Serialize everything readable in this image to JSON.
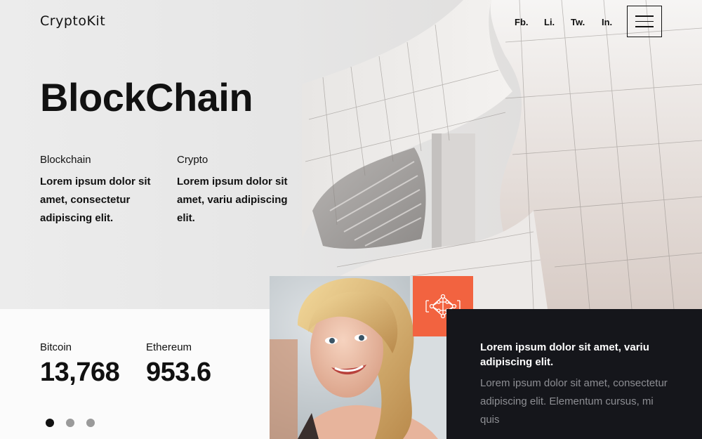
{
  "header": {
    "brand": "CryptoKit",
    "social": [
      {
        "label": "Fb."
      },
      {
        "label": "Li."
      },
      {
        "label": "Tw."
      },
      {
        "label": "In."
      }
    ],
    "menu_icon": "hamburger-menu-icon"
  },
  "hero": {
    "title": "BlockChain",
    "features": [
      {
        "label": "Blockchain",
        "text": "Lorem ipsum dolor sit amet, consectetur adipiscing elit."
      },
      {
        "label": "Crypto",
        "text": "Lorem ipsum dolor sit amet, variu adipiscing elit."
      }
    ]
  },
  "stats": {
    "items": [
      {
        "label": "Bitcoin",
        "value": "13,768"
      },
      {
        "label": "Ethereum",
        "value": "953.6"
      }
    ],
    "carousel_dots": 3,
    "active_dot": 0
  },
  "feature_icon": "network-nodes-icon",
  "info": {
    "heading": "Lorem ipsum dolor sit amet, variu adipiscing elit.",
    "body": "Lorem ipsum dolor sit amet, consectetur adipiscing elit. Elementum cursus, mi quis"
  },
  "colors": {
    "accent": "#f26340",
    "dark": "#15161b",
    "text": "#111111"
  }
}
